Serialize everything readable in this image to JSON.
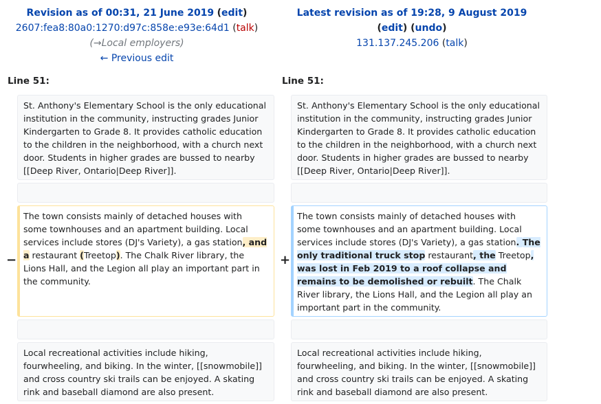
{
  "left_header": {
    "title": "Revision as of 00:31, 21 June 2019",
    "edit": "edit",
    "user": "2607:fea8:80a0:1270:d97c:858e:e93e:64d1",
    "talk": "talk",
    "summary": "(→Local employers)",
    "prev": "← Previous edit"
  },
  "right_header": {
    "title": "Latest revision as of 19:28, 9 August 2019",
    "edit": "edit",
    "undo": "undo",
    "user": "131.137.245.206",
    "talk": "talk"
  },
  "line_label": "Line 51:",
  "markers": {
    "minus": "−",
    "plus": "+"
  },
  "context1": "St. Anthony's Elementary School is the only educational institution in the community, instructing grades Junior Kindergarten to Grade 8. It provides catholic education to the children in the neighborhood, with a church next door. Students in higher grades are bussed to nearby [[Deep River, Ontario|Deep River]].",
  "context2": "Local recreational activities include hiking, fourwheeling, and biking. In the winter, [[snowmobile]] and cross country ski trails can be enjoyed. A skating rink and baseball diamond are also present.",
  "deleted": [
    {
      "t": "The town consists mainly of detached houses with some townhouses and an apartment building. Local services include stores (DJ's Variety), a gas station",
      "m": false
    },
    {
      "t": ", and a",
      "m": true
    },
    {
      "t": " restaurant ",
      "m": false
    },
    {
      "t": "(",
      "m": true
    },
    {
      "t": "Treetop",
      "m": false
    },
    {
      "t": ")",
      "m": true
    },
    {
      "t": ". The Chalk River library, the Lions Hall, and the Legion all play an important part in the community.",
      "m": false
    }
  ],
  "added": [
    {
      "t": "The town consists mainly of detached houses with some townhouses and an apartment building. Local services include stores (DJ's Variety), a gas station",
      "m": false
    },
    {
      "t": ". ",
      "m": true
    },
    {
      "t": " ",
      "m": false
    },
    {
      "t": "The only traditional truck stop",
      "m": true
    },
    {
      "t": " restaurant",
      "m": false
    },
    {
      "t": ", the",
      "m": true
    },
    {
      "t": " Treetop",
      "m": false
    },
    {
      "t": ", was lost in Feb 2019 to a roof collapse and remains to be demolished or rebuilt",
      "m": true
    },
    {
      "t": ". The Chalk River library, the Lions Hall, and the Legion all play an important part in the community.",
      "m": false
    }
  ]
}
